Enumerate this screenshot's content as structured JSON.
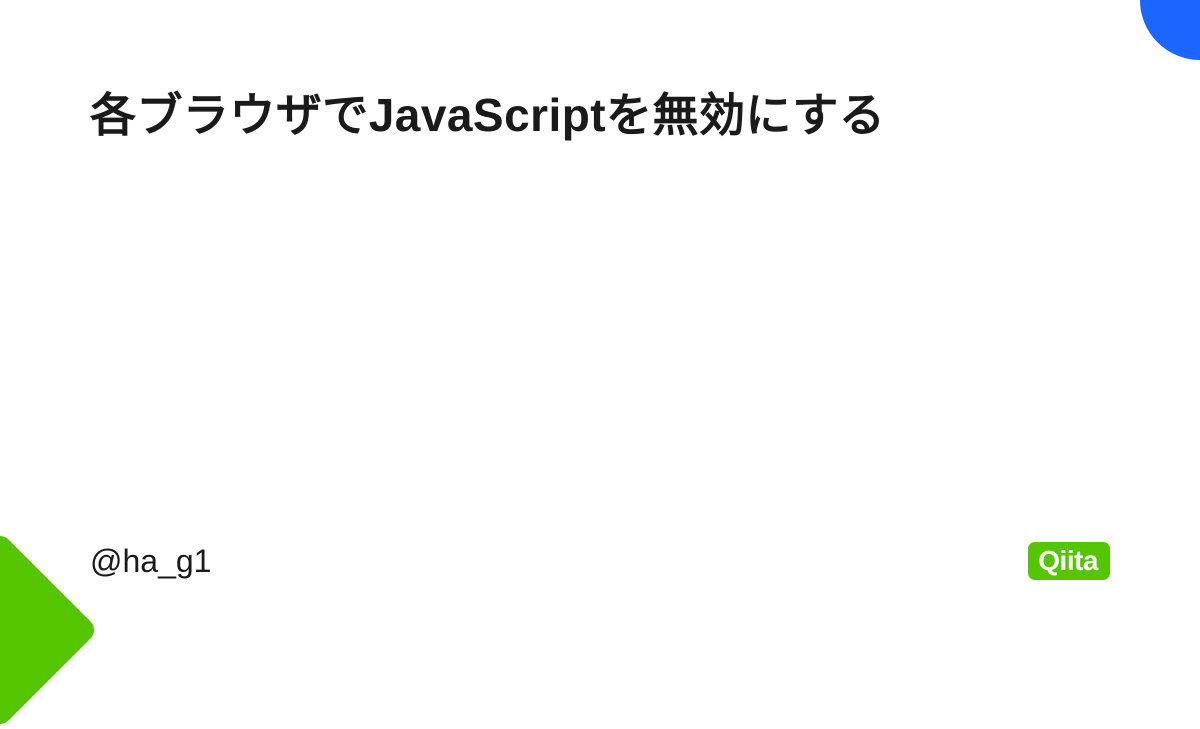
{
  "article": {
    "title": "各ブラウザでJavaScriptを無効にする",
    "author": "@ha_g1"
  },
  "brand": {
    "name": "Qiita"
  },
  "colors": {
    "accent_green": "#55c500",
    "accent_blue": "#1a66ff"
  }
}
